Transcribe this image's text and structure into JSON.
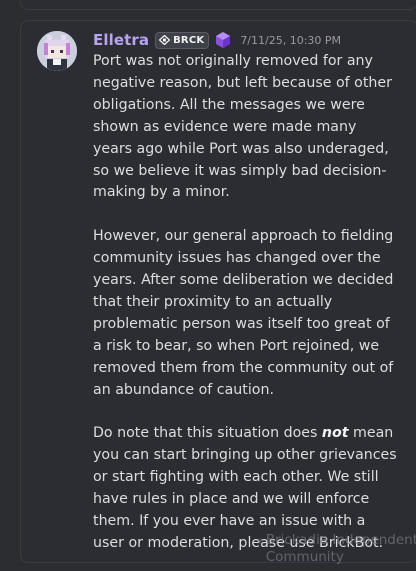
{
  "message": {
    "author": "Elletra",
    "tag": {
      "label": "BRCK",
      "icon": "lego-brick-icon"
    },
    "badge_icon": "purple-gem-icon",
    "timestamp": "7/11/25, 10:30 PM",
    "avatar_icon": "pixel-anime-avatar-icon",
    "paragraphs": [
      "Port was not originally removed for any negative reason, but left because of other obligations. All the messages we were shown as evidence were made many years ago while Port was also underaged, so we believe it was simply bad decision-making by a minor.",
      "However, our general approach to fielding community issues has changed over the years. After some deliberation we decided that their proximity to an actually problematic person was itself too great of a risk to bear, so when Port rejoined, we removed them from the community out of an abundance of caution."
    ],
    "paragraph3": {
      "before": "Do note that this situation does ",
      "emphasis": "not",
      "after": " mean you can start bringing up other grievances or start fighting with each other. We still have rules in place and we will enforce them. If you ever have an issue with a user or moderation, please use BrickBot."
    }
  },
  "watermark": {
    "line1": "Brickadia Independent",
    "line2": "Community"
  },
  "colors": {
    "background": "#2b2d31",
    "card": "#2c2d32",
    "author": "#b9a3f0",
    "text": "#dbdee1",
    "timestamp": "#949ba4"
  }
}
